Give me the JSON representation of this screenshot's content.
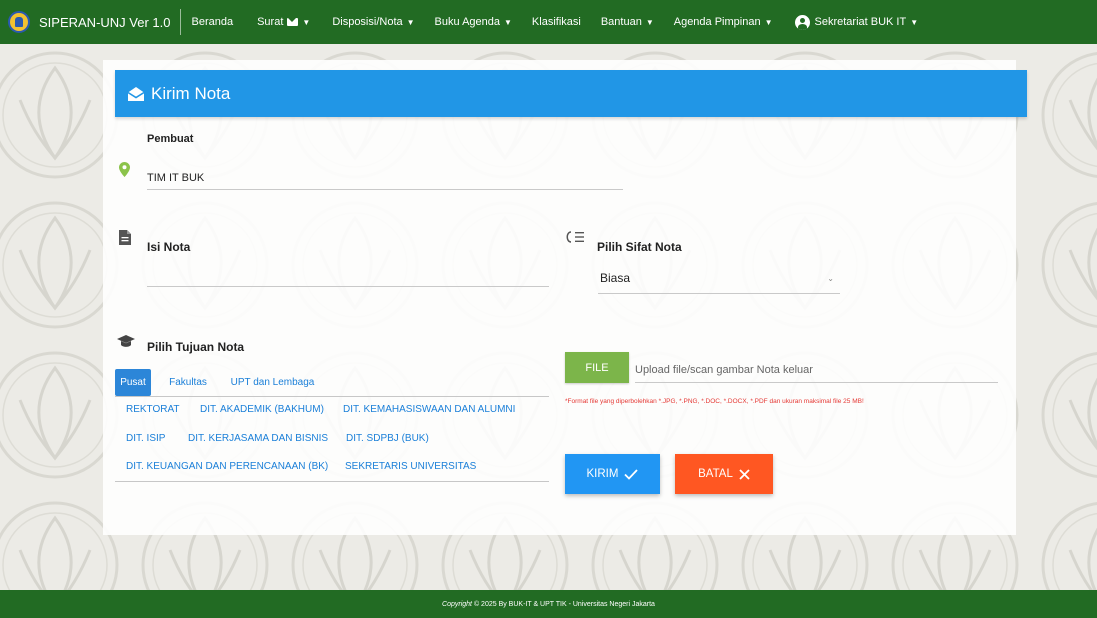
{
  "app": {
    "name": "SIPERAN-UNJ Ver 1.0"
  },
  "nav": {
    "beranda": "Beranda",
    "surat": "Surat",
    "disposisi": "Disposisi/Nota",
    "buku_agenda": "Buku Agenda",
    "klasifikasi": "Klasifikasi",
    "bantuan": "Bantuan",
    "agenda_pimpinan": "Agenda Pimpinan",
    "user": "Sekretariat BUK IT"
  },
  "card": {
    "title": "Kirim Nota"
  },
  "form": {
    "pembuat_label": "Pembuat",
    "pembuat_value": "TIM IT BUK",
    "isi_label": "Isi Nota",
    "isi_value": "",
    "sifat_label": "Pilih Sifat Nota",
    "sifat_selected": "Biasa",
    "tujuan_label": "Pilih Tujuan Nota",
    "tabs": [
      "Pusat",
      "Fakultas",
      "UPT dan Lembaga"
    ],
    "destinations": [
      "REKTORAT",
      "DIT. AKADEMIK (BAKHUM)",
      "DIT. KEMAHASISWAAN DAN ALUMNI",
      "DIT. ISIP",
      "DIT. KERJASAMA DAN BISNIS",
      "DIT. SDPBJ (BUK)",
      "DIT. KEUANGAN DAN PERENCANAAN (BK)",
      "SEKRETARIS UNIVERSITAS"
    ],
    "file_button": "FILE",
    "file_placeholder": "Upload file/scan gambar Nota keluar",
    "file_note": "*Format file yang diperbolehkan *.JPG, *.PNG, *.DOC, *.DOCX, *.PDF dan ukuran maksimal file 25 MB!",
    "kirim": "KIRIM",
    "batal": "BATAL"
  },
  "footer": {
    "copyright_word": "Copyright",
    "text": " © 2025 By BUK-IT & UPT TIK - Universitas Negeri Jakarta"
  },
  "colors": {
    "navbar": "#226b23",
    "header": "#2196e6",
    "file_button": "#7cb54a",
    "kirim": "#2196f3",
    "batal": "#ff5722",
    "link": "#1a7fd8",
    "note": "#e53935"
  },
  "icons": {
    "logo": "unj-logo-icon",
    "mail": "envelope-icon",
    "user": "user-circle-icon",
    "card": "envelope-open-icon",
    "pembuat": "map-marker-icon",
    "isi": "file-text-icon",
    "sifat": "list-check-icon",
    "tujuan": "graduation-cap-icon",
    "kirim": "check-icon",
    "batal": "close-icon"
  }
}
